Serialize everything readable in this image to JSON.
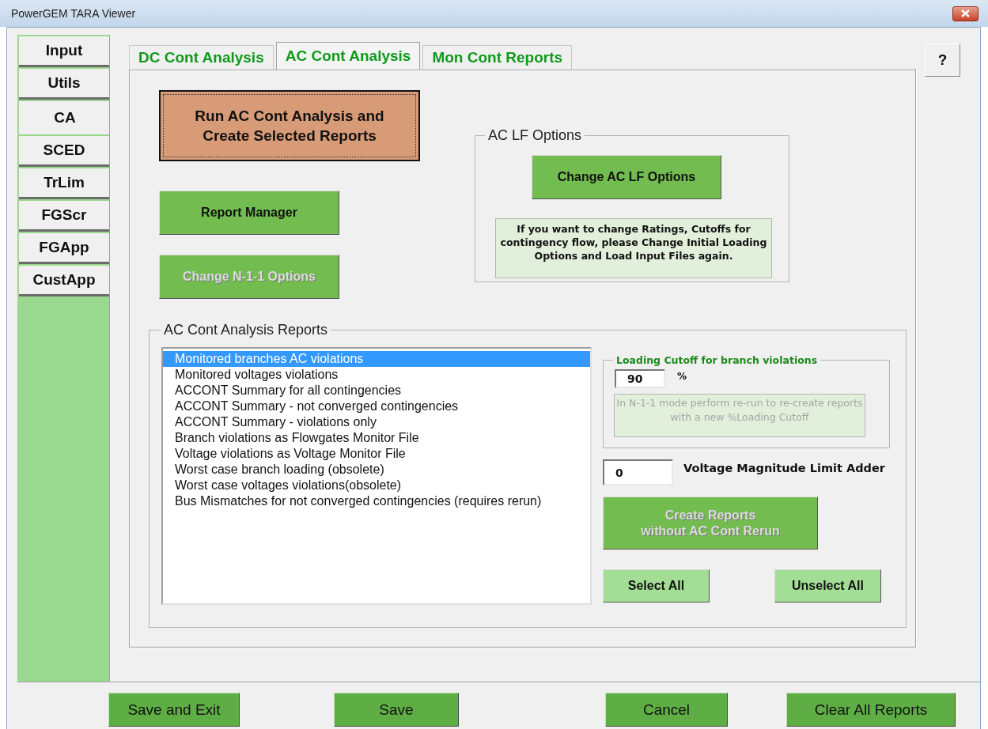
{
  "window": {
    "title": "PowerGEM TARA Viewer"
  },
  "side_tabs": [
    {
      "label": "Input",
      "selected": false
    },
    {
      "label": "Utils",
      "selected": false
    },
    {
      "label": "CA",
      "selected": true
    },
    {
      "label": "SCED",
      "selected": false
    },
    {
      "label": "TrLim",
      "selected": false
    },
    {
      "label": "FGScr",
      "selected": false
    },
    {
      "label": "FGApp",
      "selected": false
    },
    {
      "label": "CustApp",
      "selected": false
    }
  ],
  "tabs": [
    {
      "label": "DC Cont Analysis",
      "selected": false
    },
    {
      "label": "AC Cont Analysis",
      "selected": true
    },
    {
      "label": "Mon Cont Reports",
      "selected": false
    }
  ],
  "help_button": "?",
  "run_button": {
    "label": "Run AC Cont Analysis and\nCreate Selected Reports"
  },
  "buttons": [
    {
      "label": "Report Manager",
      "disabled": false
    },
    {
      "label": "Change N-1-1 Options",
      "disabled": true
    }
  ],
  "lf_options": {
    "title": "AC LF Options",
    "button": {
      "label": "Change AC LF Options",
      "disabled": false
    },
    "note": "If you want to change Ratings, Cutoffs for contingency flow, please Change Initial Loading Options and Load Input Files again."
  },
  "reports": {
    "title": "AC Cont Analysis Reports",
    "items": [
      {
        "label": "Monitored branches AC violations",
        "selected": true
      },
      {
        "label": "Monitored voltages violations",
        "selected": false
      },
      {
        "label": "ACCONT Summary for all contingencies",
        "selected": false
      },
      {
        "label": "ACCONT Summary - not converged contingencies",
        "selected": false
      },
      {
        "label": "ACCONT Summary - violations only",
        "selected": false
      },
      {
        "label": "Branch violations as Flowgates Monitor File",
        "selected": false
      },
      {
        "label": "Voltage violations as Voltage Monitor File",
        "selected": false
      },
      {
        "label": "Worst case branch loading (obsolete)",
        "selected": false
      },
      {
        "label": "Worst case voltages violations(obsolete)",
        "selected": false
      },
      {
        "label": "Bus Mismatches for not converged contingencies (requires rerun)",
        "selected": false
      }
    ],
    "cutoff": {
      "title": "Loading Cutoff for branch violations",
      "value": "90",
      "unit": "%",
      "note": "In N-1-1 mode perform re-run to re-create reports with a new %Loading Cutoff",
      "note_disabled": true
    },
    "voltage_adder": {
      "value": "0",
      "label": "Voltage Magnitude Limit Adder"
    },
    "create_button": {
      "label": "Create Reports\nwithout AC Cont Rerun",
      "disabled": true
    },
    "select_all": "Select All",
    "unselect_all": "Unselect All"
  },
  "footer_buttons": [
    "Save and Exit",
    "Save",
    "Cancel",
    "Clear All Reports"
  ]
}
